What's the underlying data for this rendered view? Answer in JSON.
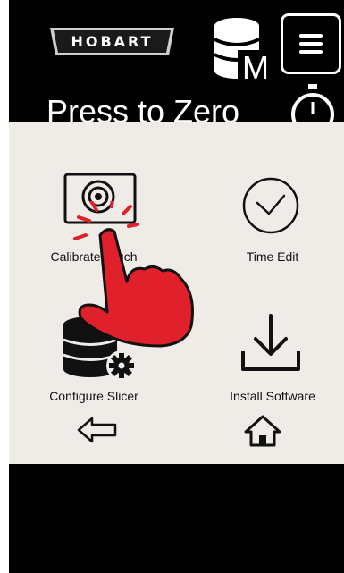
{
  "header": {
    "brand": "HOBART",
    "screen_title": "Press to Zero",
    "icons": [
      "database-m-icon",
      "menu-icon",
      "stopwatch-icon"
    ]
  },
  "menu": {
    "items": [
      {
        "label": "Calibrate Touch",
        "icon": "touchscreen-icon"
      },
      {
        "label": "Time Edit",
        "icon": "clock-icon"
      },
      {
        "label": "Configure Slicer",
        "icon": "database-gear-icon"
      },
      {
        "label": "Install Software",
        "icon": "download-icon"
      }
    ],
    "back_icon": "back-arrow-icon",
    "home_icon": "home-icon"
  },
  "colors": {
    "screen_background": "#000000",
    "panel_background": "#efece8",
    "touch_indicator": "#e0202a"
  }
}
